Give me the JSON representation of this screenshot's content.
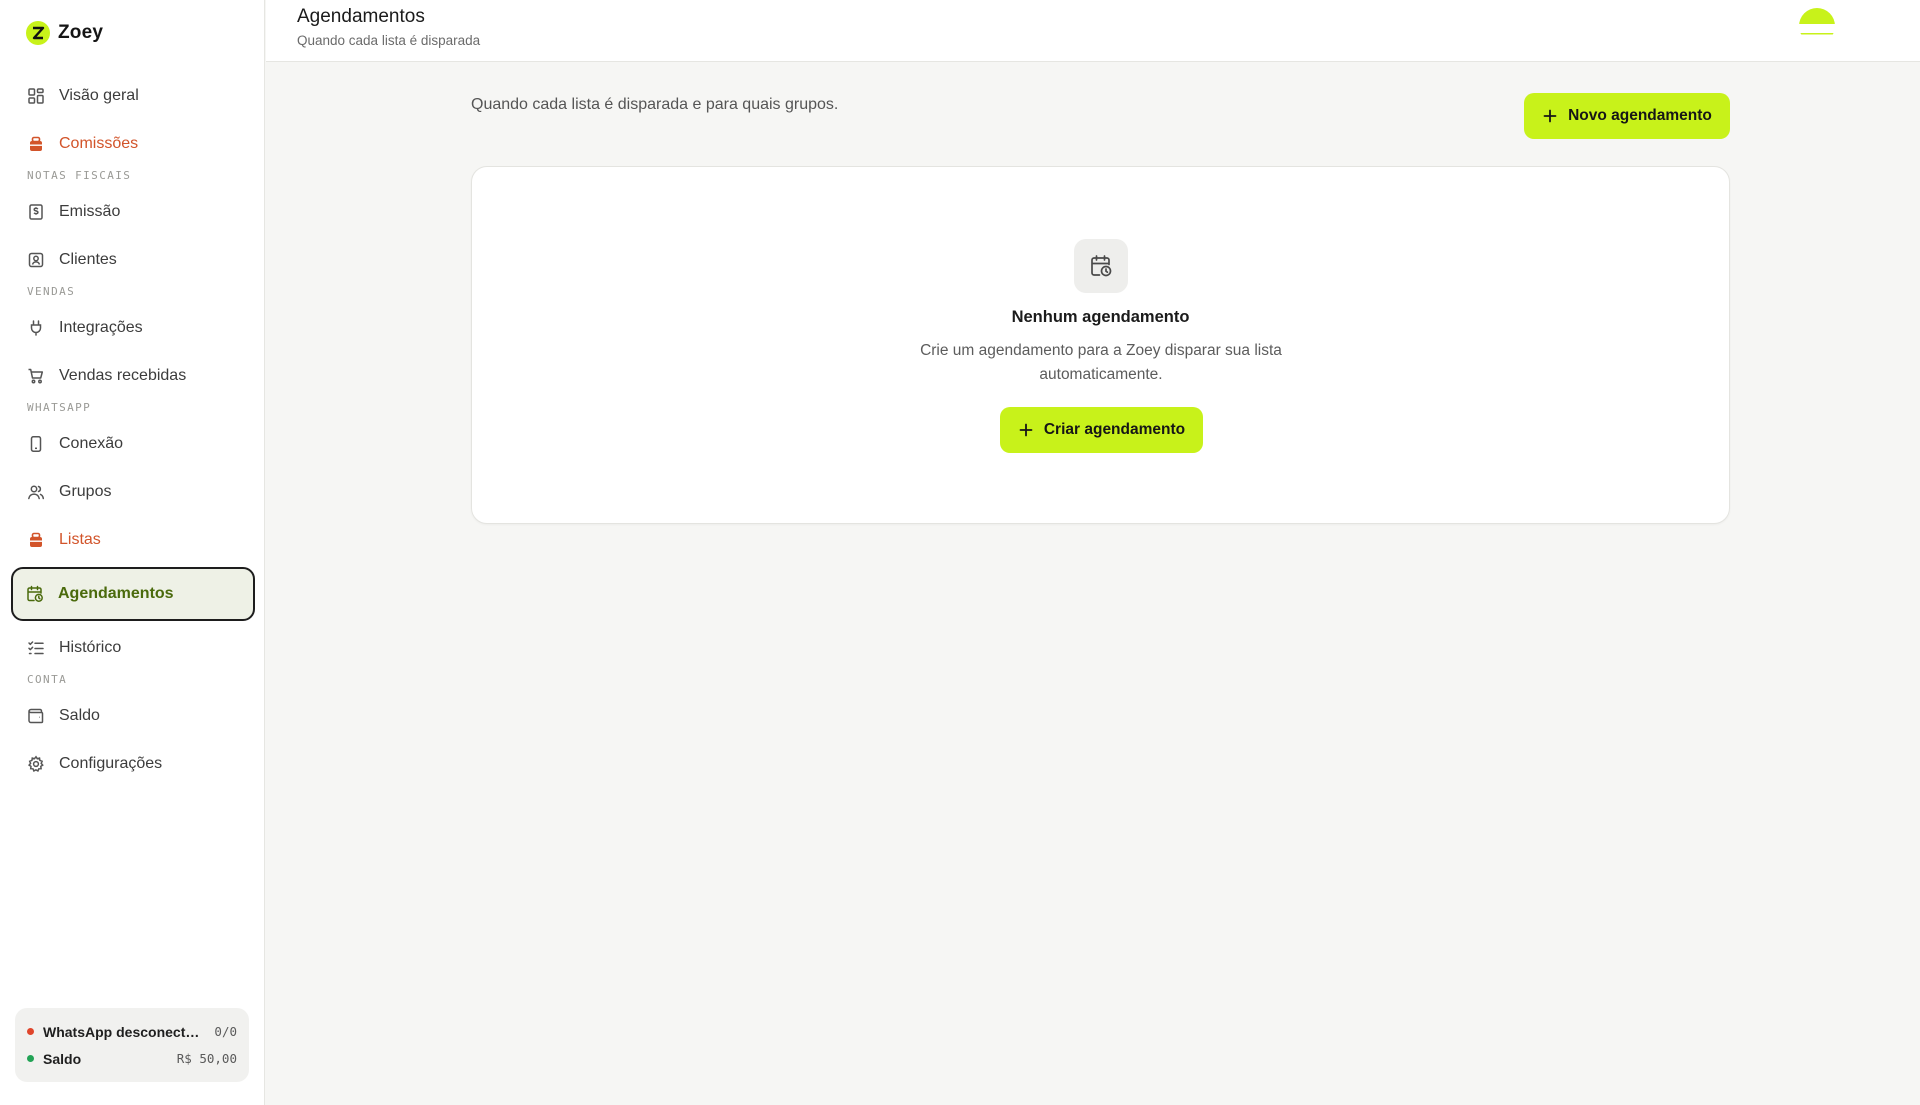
{
  "brand": {
    "name": "Zoey",
    "logo_letter": "Z"
  },
  "header": {
    "title": "Agendamentos",
    "subtitle": "Quando cada lista é disparada"
  },
  "sidebar": {
    "items": [
      {
        "label": "Visão geral",
        "icon": "grid-icon"
      },
      {
        "label": "Comissões",
        "icon": "gift-icon"
      },
      {
        "section": "NOTAS FISCAIS"
      },
      {
        "label": "Emissão",
        "icon": "receipt-icon"
      },
      {
        "label": "Clientes",
        "icon": "contact-icon"
      },
      {
        "section": "VENDAS"
      },
      {
        "label": "Integrações",
        "icon": "plug-icon"
      },
      {
        "label": "Vendas recebidas",
        "icon": "cart-icon"
      },
      {
        "section": "WHATSAPP"
      },
      {
        "label": "Conexão",
        "icon": "phone-icon"
      },
      {
        "label": "Grupos",
        "icon": "users-icon"
      },
      {
        "label": "Listas",
        "icon": "gift-icon"
      },
      {
        "label": "Agendamentos",
        "icon": "calendar-clock-icon",
        "active": true
      },
      {
        "label": "Histórico",
        "icon": "list-check-icon"
      },
      {
        "section": "CONTA"
      },
      {
        "label": "Saldo",
        "icon": "wallet-icon"
      },
      {
        "label": "Configurações",
        "icon": "gear-icon"
      }
    ],
    "status": [
      {
        "label": "WhatsApp desconectado",
        "value": "0/0",
        "color": "#e0452b"
      },
      {
        "label": "Saldo",
        "value": "R$ 50,00",
        "color": "#22a355"
      }
    ]
  },
  "main": {
    "description": "Quando cada lista é disparada e para quais grupos.",
    "new_button": "Novo agendamento",
    "empty": {
      "title": "Nenhum agendamento",
      "text": "Crie um agendamento para a Zoey disparar sua lista automaticamente.",
      "button": "Criar agendamento"
    }
  },
  "colors": {
    "accent": "#c8f21a",
    "hot": "#d2542a",
    "active_text": "#4a6a0c"
  }
}
